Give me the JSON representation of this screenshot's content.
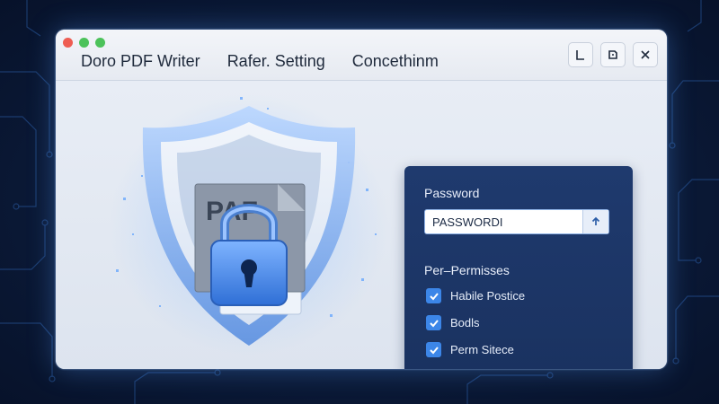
{
  "window": {
    "traffic_lights": [
      "close",
      "minimize",
      "maximize"
    ]
  },
  "menu": {
    "items": [
      "Doro PDF Writer",
      "Rafer. Setting",
      "Concethinm"
    ]
  },
  "window_controls": [
    "minimize-icon",
    "restore-icon",
    "close-icon"
  ],
  "illustration": {
    "doc_text": "PAF",
    "icons": [
      "shield-icon",
      "padlock-icon"
    ]
  },
  "password": {
    "label": "Password",
    "value": "PASSWORDI"
  },
  "permissions": {
    "title": "Per–Permisses",
    "items": [
      {
        "label": "Habile Postice",
        "checked": true
      },
      {
        "label": "Bodls",
        "checked": true
      },
      {
        "label": "Perm Sitece",
        "checked": true
      }
    ]
  },
  "colors": {
    "background": "#0b1a38",
    "panel": "#1f3a6e",
    "checkbox": "#3c86e8",
    "shield": "#4f86d8"
  }
}
